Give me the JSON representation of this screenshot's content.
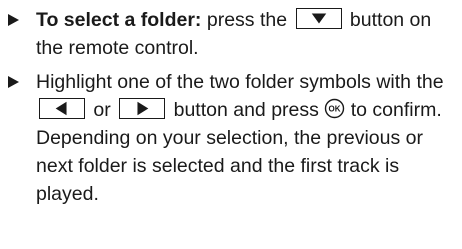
{
  "steps": [
    {
      "bold_lead": "To select a folder:",
      "text_before_key": " press the",
      "key_icon": "down-arrow-icon",
      "text_after_key": " button on the remote control."
    },
    {
      "text_1": "Highlight one of the two folder symbols with the",
      "key_left_icon": "left-arrow-icon",
      "text_or": " or ",
      "key_right_icon": "right-arrow-icon",
      "text_2": " button and press",
      "ok_icon": "ok-button-icon",
      "ok_label": "OK",
      "text_3": " to confirm.",
      "followup": "Depending on your selection, the previous or next folder is selected and the first track is played."
    }
  ]
}
